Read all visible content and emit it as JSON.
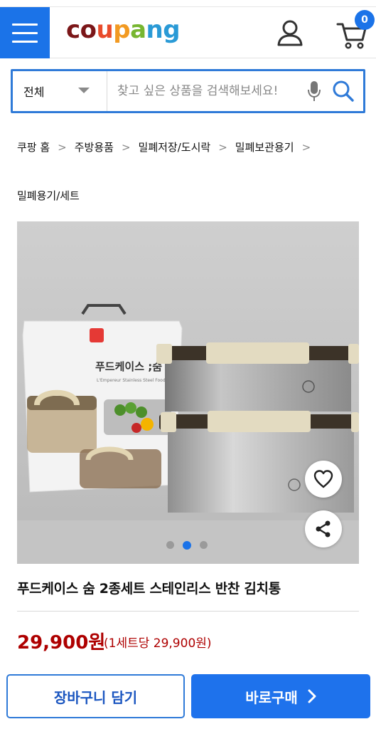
{
  "header": {
    "logo_letters": [
      "c",
      "o",
      "u",
      "p",
      "a",
      "n",
      "g"
    ],
    "logo_colors": [
      "#7b1618",
      "#7b1618",
      "#e94b2b",
      "#f29a22",
      "#77b630",
      "#2a9ad6",
      "#2a9ad6"
    ],
    "cart_count": "0",
    "accent": "#1b73e8"
  },
  "search": {
    "category": "전체",
    "placeholder": "찾고 싶은 상품을 검색해보세요!"
  },
  "breadcrumb": {
    "items": [
      "쿠팡 홈",
      "주방용품",
      "밀폐저장/도시락",
      "밀폐보관용기"
    ],
    "last": "밀폐용기/세트"
  },
  "product": {
    "box_title": "푸드케이스 ;숨 2종 세트",
    "box_subtitle": "L'Empereur Stainless Steel Food Case 2p Set",
    "title": "푸드케이스 숨 2종세트 스테인리스 반찬 김치통",
    "price": "29,900원",
    "unit_price": "(1세트당 29,900원)",
    "price_color": "#ae0000",
    "gallery": {
      "total": 3,
      "active": 2
    }
  },
  "actions": {
    "cart_label": "장바구니 담기",
    "buy_label": "바로구매"
  }
}
